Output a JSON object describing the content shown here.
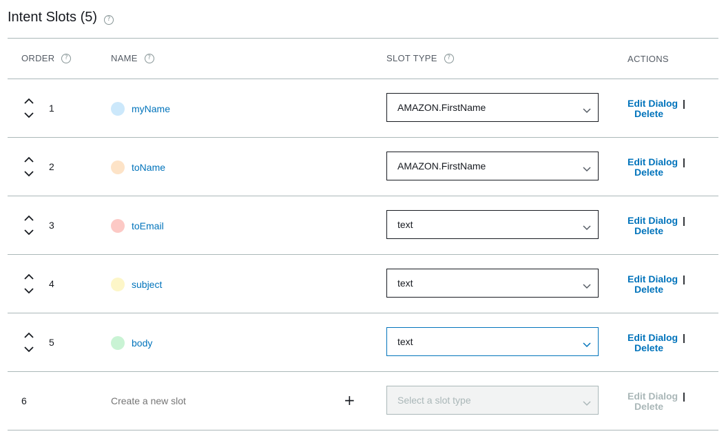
{
  "header": {
    "title": "Intent Slots (5)",
    "help_icon": "question-circle-icon"
  },
  "columns": {
    "order": "ORDER",
    "name": "NAME",
    "slot_type": "SLOT TYPE",
    "actions": "ACTIONS"
  },
  "slots": [
    {
      "order": "1",
      "name": "myName",
      "type": "AMAZON.FirstName",
      "color": "#cce8fb"
    },
    {
      "order": "2",
      "name": "toName",
      "type": "AMAZON.FirstName",
      "color": "#fde3c7"
    },
    {
      "order": "3",
      "name": "toEmail",
      "type": "text",
      "color": "#fcc9c5"
    },
    {
      "order": "4",
      "name": "subject",
      "type": "text",
      "color": "#fdf6c8"
    },
    {
      "order": "5",
      "name": "body",
      "type": "text",
      "color": "#c9f3d4"
    }
  ],
  "actions": {
    "edit": "Edit Dialog",
    "delete": "Delete",
    "separator": "|"
  },
  "new_slot": {
    "order": "6",
    "placeholder": "Create a new slot",
    "add_icon": "+",
    "type_placeholder": "Select a slot type"
  },
  "colors": {
    "link": "#0073bb",
    "border": "#aab7b8",
    "text": "#16191f",
    "muted": "#aab7b8"
  }
}
